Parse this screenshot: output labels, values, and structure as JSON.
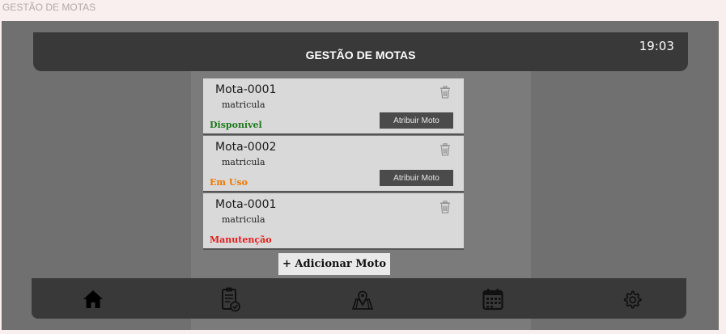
{
  "window": {
    "frame_label": "GESTÃO DE MOTAS"
  },
  "header": {
    "title": "GESTÃO DE MOTAS",
    "time": "19:03"
  },
  "motas": [
    {
      "name": "Mota-0001",
      "plate": "matricula",
      "status": "Disponível",
      "status_color": "#1f7a1f",
      "assign_label": "Atribuir Moto"
    },
    {
      "name": "Mota-0002",
      "plate": "matricula",
      "status": "Em Uso",
      "status_color": "#f07800",
      "assign_label": "Atribuir Moto"
    },
    {
      "name": "Mota-0001",
      "plate": "matricula",
      "status": "Manutenção",
      "status_color": "#e11d1d"
    }
  ],
  "add_button": {
    "label": "+ Adicionar Moto"
  },
  "nav": {
    "items": [
      {
        "icon": "home-icon"
      },
      {
        "icon": "clipboard-check-icon"
      },
      {
        "icon": "map-location-icon"
      },
      {
        "icon": "calendar-icon"
      },
      {
        "icon": "gear-icon"
      }
    ]
  },
  "colors": {
    "frame_bg": "#707070",
    "bar_bg": "#393939",
    "card_bg": "#d9d9d9"
  }
}
